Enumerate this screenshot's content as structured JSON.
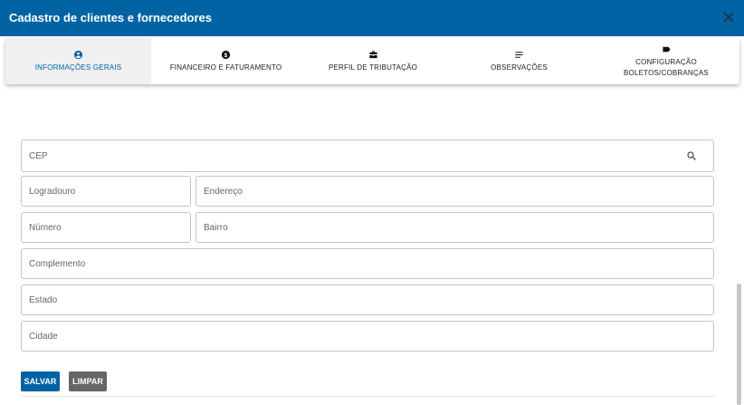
{
  "window": {
    "title": "Cadastro de clientes e fornecedores"
  },
  "tabs": [
    {
      "label": "INFORMAÇÕES GERAIS",
      "icon": "account-circle-icon",
      "active": true
    },
    {
      "label": "FINANCEIRO E FATURAMENTO",
      "icon": "dollar-circle-icon",
      "active": false
    },
    {
      "label": "PERFIL DE TRIBUTAÇÃO",
      "icon": "briefcase-icon",
      "active": false
    },
    {
      "label": "OBSERVAÇÕES",
      "icon": "notes-icon",
      "active": false
    },
    {
      "label": "CONFIGURAÇÃO BOLETOS/COBRANÇAS",
      "icon": "label-tag-icon",
      "active": false
    }
  ],
  "form": {
    "cep": {
      "placeholder": "CEP",
      "value": ""
    },
    "logradouro": {
      "placeholder": "Logradouro",
      "value": ""
    },
    "endereco": {
      "placeholder": "Endereço",
      "value": ""
    },
    "numero": {
      "placeholder": "Número",
      "value": ""
    },
    "bairro": {
      "placeholder": "Bairro",
      "value": ""
    },
    "complemento": {
      "placeholder": "Complemento",
      "value": ""
    },
    "estado": {
      "placeholder": "Estado",
      "value": ""
    },
    "cidade": {
      "placeholder": "Cidade",
      "value": ""
    }
  },
  "actions": {
    "save_label": "SALVAR",
    "clear_label": "LIMPAR"
  },
  "colors": {
    "primary": "#0063a3",
    "secondary_button": "#666666"
  }
}
